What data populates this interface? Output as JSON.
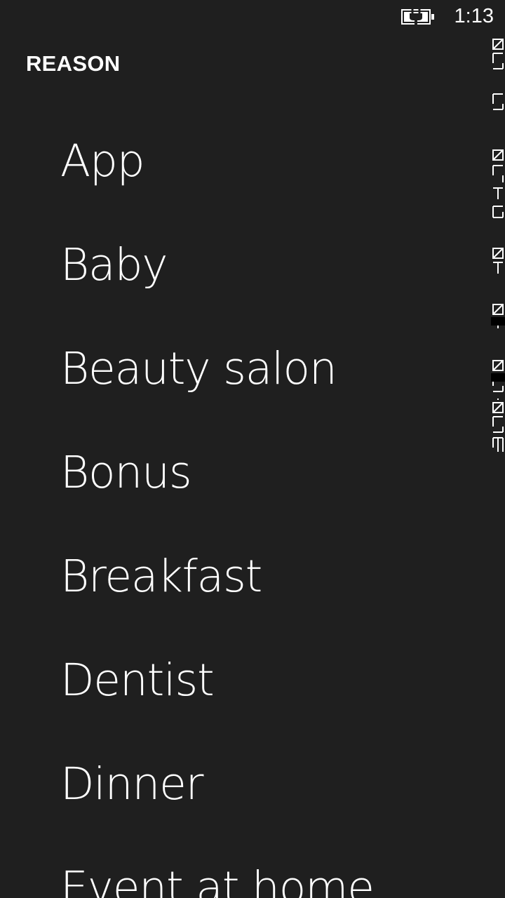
{
  "status_bar": {
    "time": "1:13",
    "battery_icon": "battery-charging-icon"
  },
  "header": {
    "title": "REASON"
  },
  "reasons": [
    {
      "label": "App"
    },
    {
      "label": "Baby"
    },
    {
      "label": "Beauty salon"
    },
    {
      "label": "Bonus"
    },
    {
      "label": "Breakfast"
    },
    {
      "label": "Dentist"
    },
    {
      "label": "Dinner"
    },
    {
      "label": "Event at home"
    }
  ],
  "colors": {
    "background": "#1f1f1f",
    "foreground": "#ffffff"
  }
}
